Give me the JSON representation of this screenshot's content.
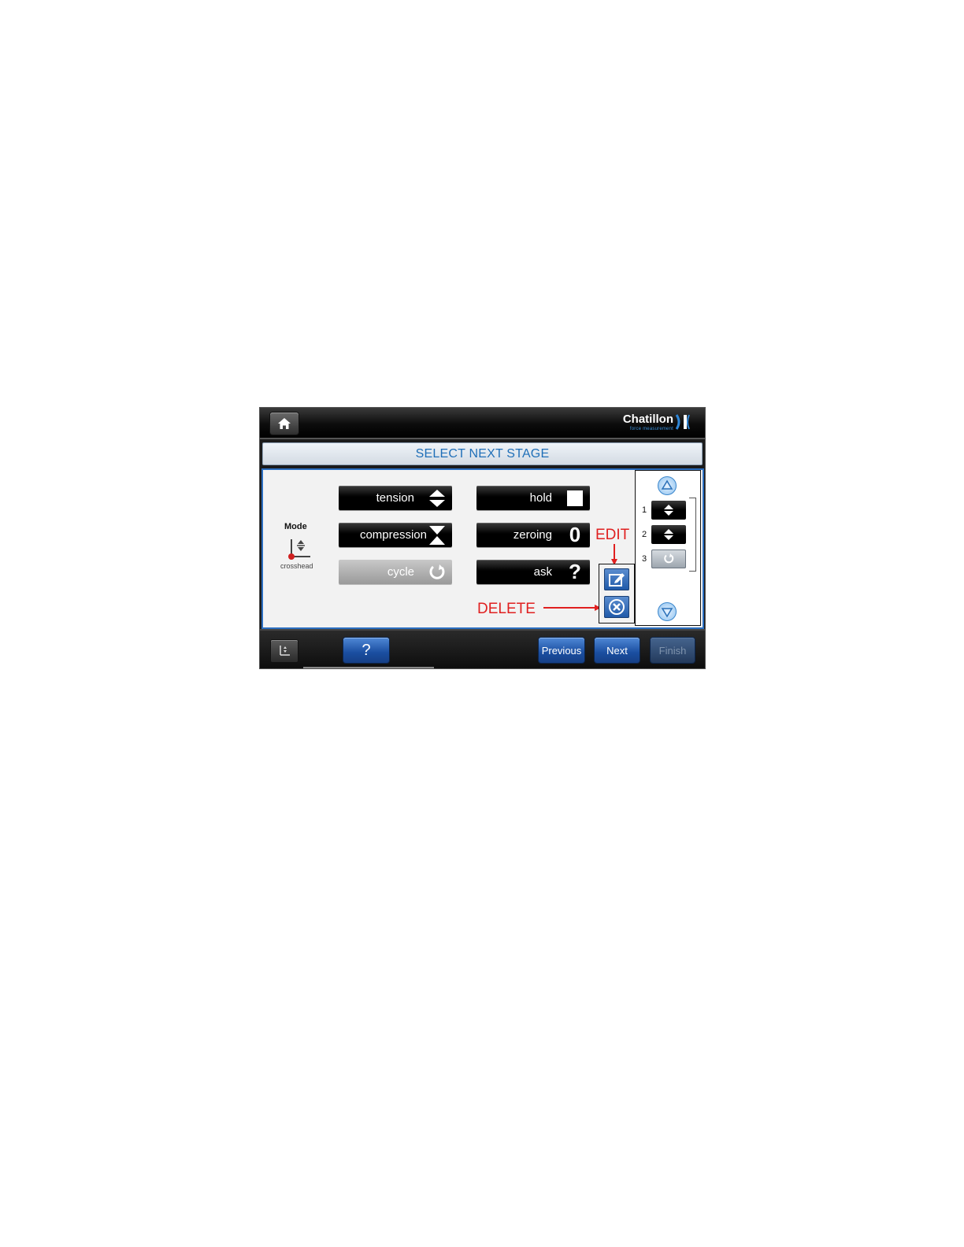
{
  "header": {
    "home_icon": "home-icon",
    "logo_word": "Chatillon",
    "logo_sub": "force measurement"
  },
  "title": "SELECT NEXT STAGE",
  "mode": {
    "label": "Mode",
    "sublabel": "crosshead",
    "icon": "crosshead-mode-icon"
  },
  "stages": [
    {
      "label": "tension",
      "icon": "tension-arrows-icon",
      "enabled": true
    },
    {
      "label": "hold",
      "icon": "hold-square-icon",
      "enabled": true
    },
    {
      "label": "compression",
      "icon": "compression-hourglass-icon",
      "enabled": true
    },
    {
      "label": "zeroing",
      "icon": "zero-icon",
      "icon_text": "0",
      "enabled": true
    },
    {
      "label": "cycle",
      "icon": "cycle-refresh-icon",
      "enabled": false
    },
    {
      "label": "ask",
      "icon": "question-icon",
      "icon_text": "?",
      "enabled": true
    }
  ],
  "annotations": {
    "edit": "EDIT",
    "delete": "DELETE"
  },
  "stage_list": {
    "items": [
      {
        "number": "1",
        "icon": "tension-arrows-icon",
        "selected": false
      },
      {
        "number": "2",
        "icon": "tension-arrows-icon",
        "selected": false
      },
      {
        "number": "3",
        "icon": "cycle-refresh-icon",
        "selected": true
      }
    ]
  },
  "footer": {
    "help_label": "?",
    "previous_label": "Previous",
    "next_label": "Next",
    "finish_label": "Finish",
    "finish_enabled": false
  },
  "colors": {
    "accent_blue": "#1f6fb8",
    "annotation_red": "#e02020"
  }
}
